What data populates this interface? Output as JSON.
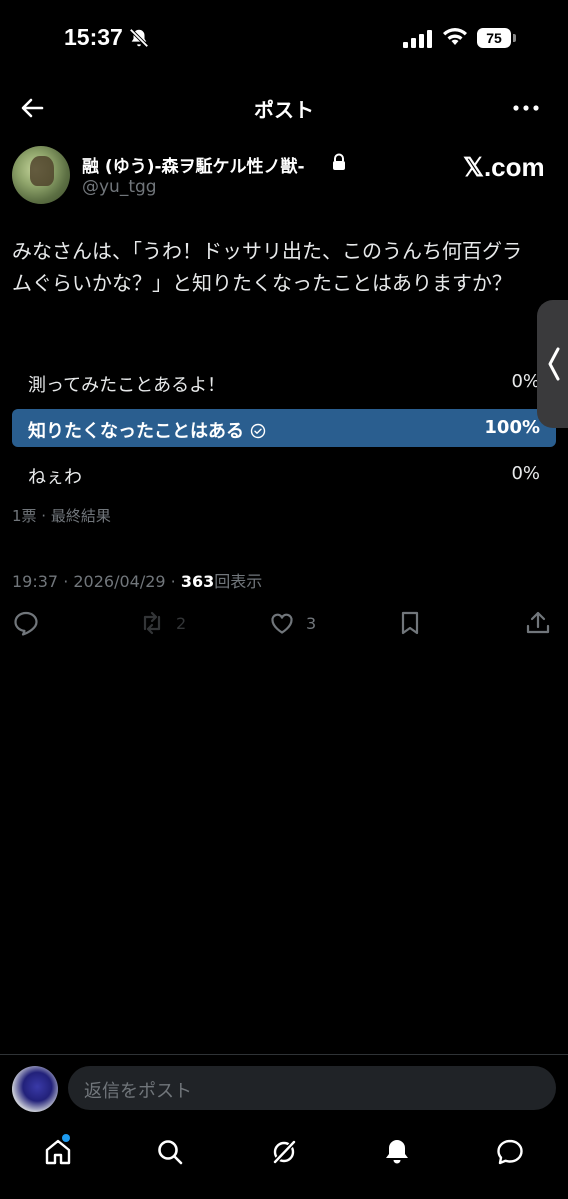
{
  "status_bar": {
    "time": "15:37",
    "battery": "75"
  },
  "header": {
    "title": "ポスト"
  },
  "author": {
    "display_name": "融 (ゆう)-森ヲ駈ケル性ノ獣-",
    "handle": "@yu_tgg",
    "source_badge": "𝕏.com"
  },
  "post": {
    "text": "みなさんは、「うわ！ドッサリ出た、このうんち何百グラムぐらいかな？」と知りたくなったことはありますか？"
  },
  "poll": {
    "options": [
      {
        "label": "測ってみたことあるよ！",
        "percent": "0%",
        "value": 0
      },
      {
        "label": "知りたくなったことはある",
        "percent": "100%",
        "value": 100
      },
      {
        "label": "ねぇわ",
        "percent": "0%",
        "value": 0
      }
    ],
    "meta": "1票 · 最終結果"
  },
  "timestamp": {
    "text": "19:37 · 2026/04/29 · ",
    "views": "363",
    "views_suffix": "回表示"
  },
  "actions": {
    "reply": {
      "icon": "reply-icon",
      "count": ""
    },
    "repost": {
      "icon": "repost-icon",
      "count": "2"
    },
    "like": {
      "icon": "heart-icon",
      "count": "3"
    },
    "bookmark": {
      "icon": "bookmark-icon",
      "count": ""
    },
    "share": {
      "icon": "share-icon",
      "count": ""
    }
  },
  "reply_bar": {
    "placeholder": "返信をポスト"
  },
  "tabbar": {
    "items": [
      "home-icon",
      "search-icon",
      "grok-icon",
      "bell-icon",
      "messages-icon"
    ]
  },
  "colors": {
    "background": "#000000",
    "poll_winner": "#2a5e8f",
    "secondary_text": "#71767b",
    "accent": "#1d9bf0"
  }
}
